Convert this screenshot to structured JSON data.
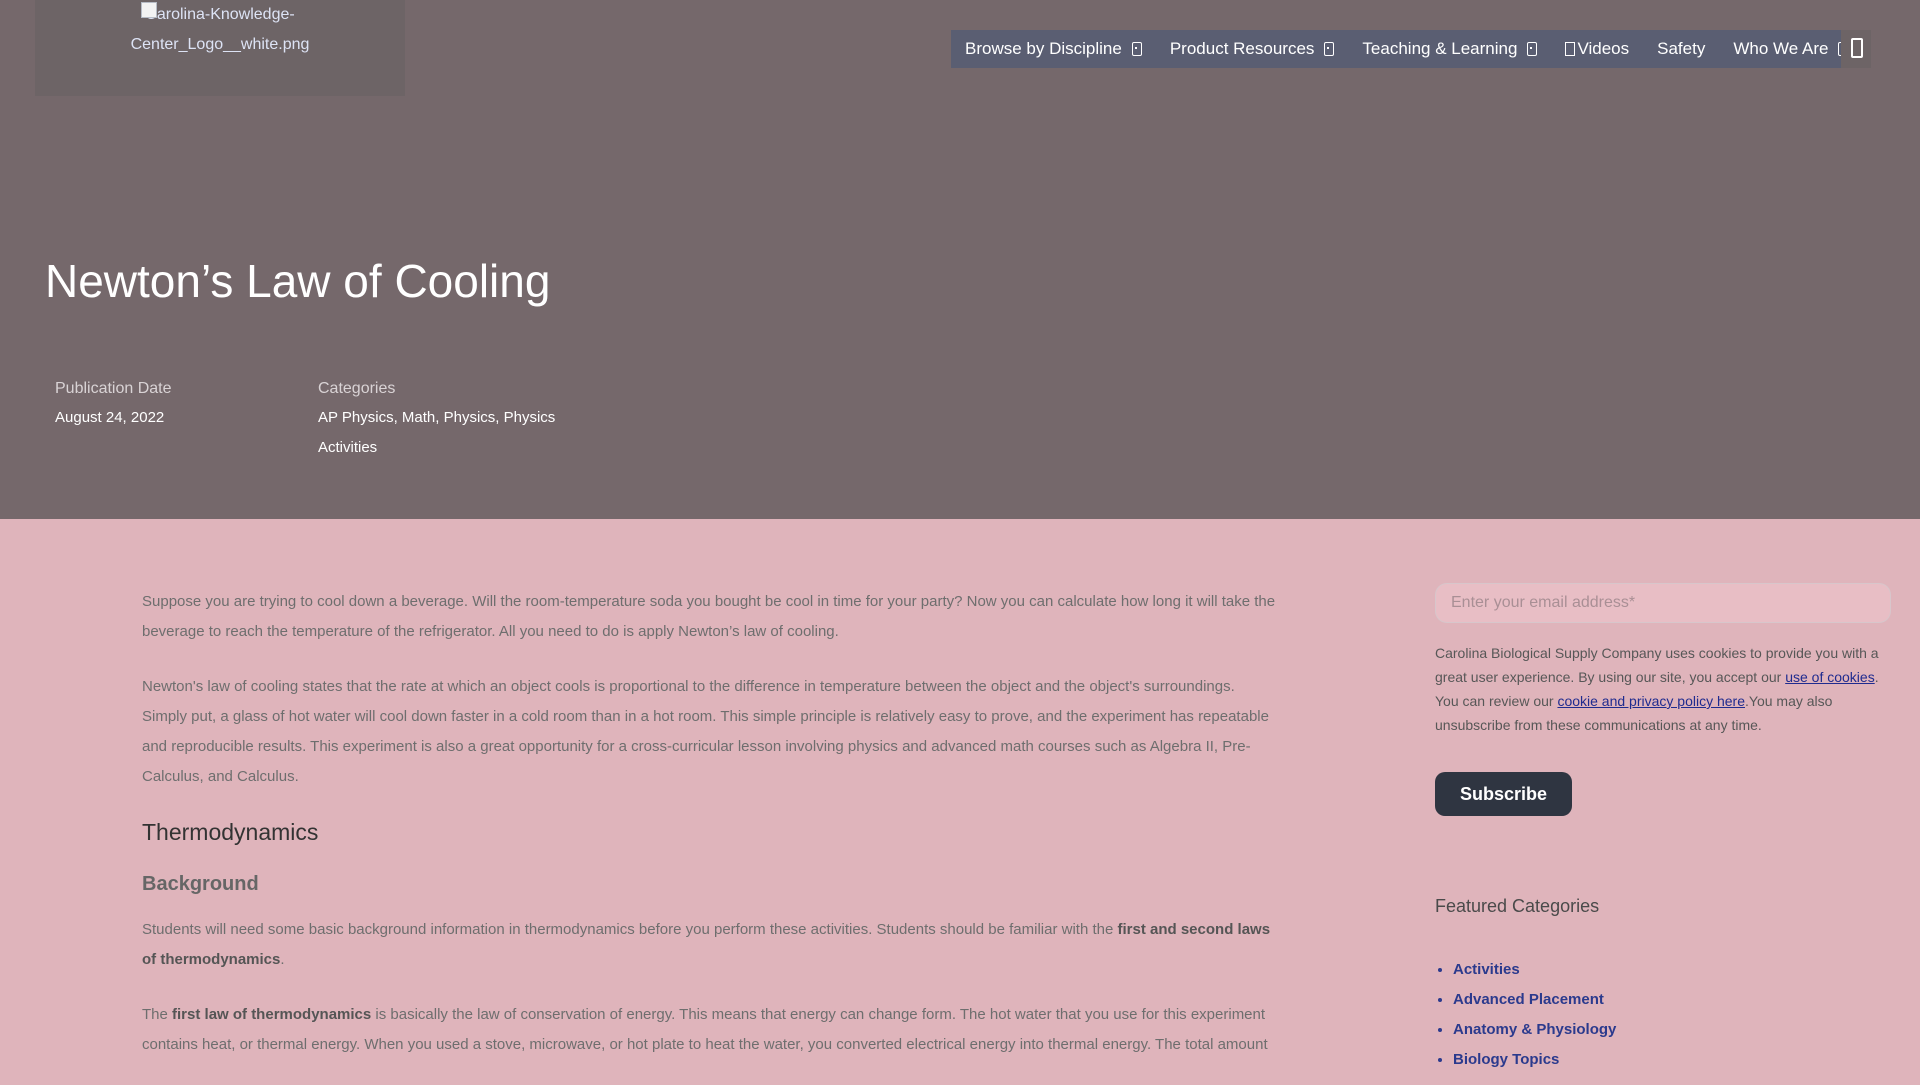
{
  "header": {
    "logo_alt": "Carolina-Knowledge-Center_Logo__white.png",
    "nav": [
      {
        "label": "Browse by Discipline",
        "has_caret": true
      },
      {
        "label": "Product Resources",
        "has_caret": true
      },
      {
        "label": "Teaching & Learning",
        "has_caret": true
      },
      {
        "label": " Videos",
        "has_caret": false
      },
      {
        "label": "Safety",
        "has_caret": false
      },
      {
        "label": "Who We Are",
        "has_caret": true
      }
    ]
  },
  "article": {
    "title": "Newton’s Law of Cooling",
    "publication_label": "Publication Date",
    "publication_date": "August 24, 2022",
    "categories_label": "Categories",
    "categories_line1": "AP Physics, Math, Physics, Physics",
    "categories_line2": "Activities",
    "intro_p1": "Suppose you are trying to cool down a beverage. Will the room-temperature soda you bought be cool in time for your party? Now you can calculate how long it will take the beverage to reach the temperature of the refrigerator. All you need to do is apply Newton’s law of cooling.",
    "intro_p2": "Newton's law of cooling states that the rate at which an object cools is proportional to the difference in temperature between the object and the object's surroundings. Simply put, a glass of hot water will cool down faster in a cold room than in a hot room. This simple principle is relatively easy to prove, and the experiment has repeatable and reproducible results. This experiment is also a great opportunity for a cross-curricular lesson involving physics and advanced math courses such as Algebra II, Pre-Calculus, and Calculus.",
    "heading_thermo": "Thermodynamics",
    "heading_background": "Background",
    "bg_p_start": "Students will need some basic background information in thermodynamics before you perform these activities. Students should be familiar with the ",
    "bg_p_bold": "first and second laws of thermodynamics",
    "bg_p_end": ".",
    "first_law_start": "The ",
    "first_law_bold": "first law of thermodynamics",
    "first_law_end": " is basically the law of conservation of energy. This means that energy can change form. The hot water that you use for this experiment contains heat, or thermal energy. When you used a stove, microwave, or hot plate to heat the water, you converted electrical energy into thermal energy. The total amount"
  },
  "sidebar": {
    "email_placeholder": "Enter your email address*",
    "consent_start": "Carolina Biological Supply Company uses cookies to provide you with a great user experience. By using our site, you accept our ",
    "consent_link1": "use of cookies",
    "consent_mid": ". You can review our ",
    "consent_link2": "cookie and privacy policy here",
    "consent_end": ".You may also unsubscribe from these communications at any time.",
    "subscribe_label": "Subscribe",
    "featured_title": "Featured Categories",
    "featured": [
      "Activities",
      "Advanced Placement",
      "Anatomy & Physiology",
      "Biology Topics"
    ]
  }
}
